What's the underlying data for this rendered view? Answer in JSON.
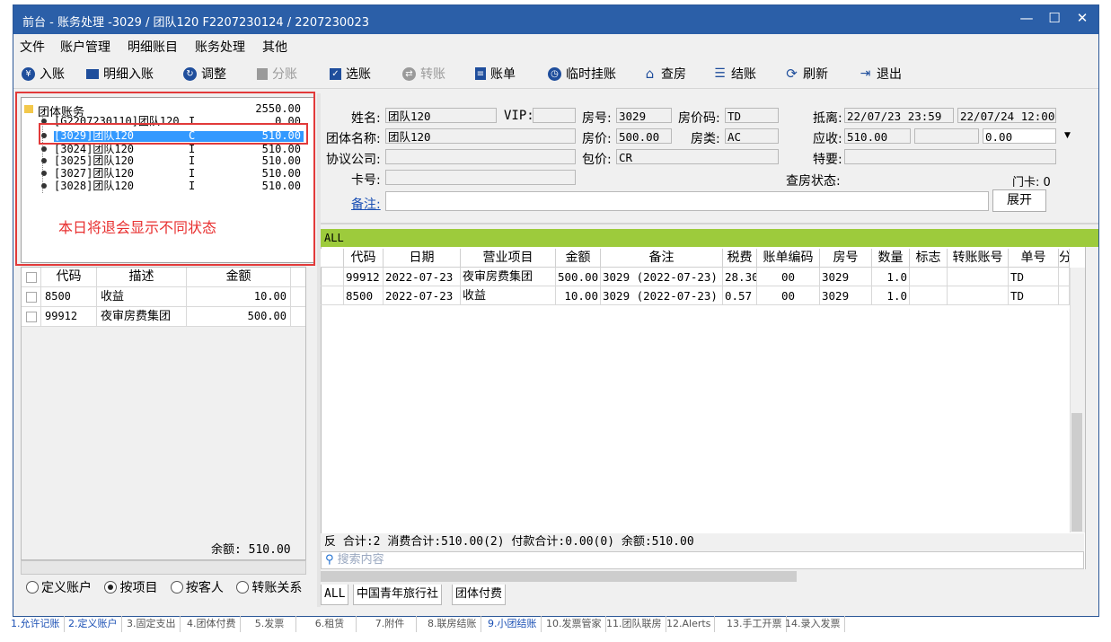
{
  "window": {
    "title": "前台 - 账务处理 -3029 / 团队120  F2207230124 / 2207230023",
    "minimize_glyph": "—",
    "maximize_glyph": "☐",
    "close_glyph": "✕"
  },
  "menu": [
    "文件",
    "账户管理",
    "明细账目",
    "账务处理",
    "其他"
  ],
  "toolbar": [
    {
      "label": "入账",
      "icon": "yen-icon",
      "enabled": true
    },
    {
      "label": "明细入账",
      "icon": "monitor-icon",
      "enabled": true
    },
    {
      "label": "调整",
      "icon": "adjust-icon",
      "enabled": true
    },
    {
      "label": "分账",
      "icon": "split-icon",
      "enabled": false
    },
    {
      "label": "选账",
      "icon": "select-icon",
      "enabled": true
    },
    {
      "label": "转账",
      "icon": "transfer-icon",
      "enabled": false
    },
    {
      "label": "账单",
      "icon": "bill-icon",
      "enabled": true
    },
    {
      "label": "临时挂账",
      "icon": "clock-icon",
      "enabled": true
    },
    {
      "label": "查房",
      "icon": "house-icon",
      "enabled": true
    },
    {
      "label": "结账",
      "icon": "coins-icon",
      "enabled": true
    },
    {
      "label": "刷新",
      "icon": "refresh-icon",
      "enabled": true
    },
    {
      "label": "退出",
      "icon": "exit-icon",
      "enabled": true
    }
  ],
  "tree": {
    "root_label": "团体账务",
    "root_amount": "2550.00",
    "items": [
      {
        "name": "[G2207230110]团队120",
        "flag": "I",
        "amount": "0.00",
        "selected": false
      },
      {
        "name": "[3029]团队120",
        "flag": "C",
        "amount": "510.00",
        "selected": true
      },
      {
        "name": "[3024]团队120",
        "flag": "I",
        "amount": "510.00",
        "selected": false
      },
      {
        "name": "[3025]团队120",
        "flag": "I",
        "amount": "510.00",
        "selected": false
      },
      {
        "name": "[3027]团队120",
        "flag": "I",
        "amount": "510.00",
        "selected": false
      },
      {
        "name": "[3028]团队120",
        "flag": "I",
        "amount": "510.00",
        "selected": false
      }
    ],
    "annotation": "本日将退会显示不同状态"
  },
  "left_grid": {
    "headers": [
      "代码",
      "描述",
      "金额"
    ],
    "rows": [
      {
        "code": "8500",
        "desc": "收益",
        "amount": "10.00"
      },
      {
        "code": "99912",
        "desc": "夜审房费集团",
        "amount": "500.00"
      }
    ],
    "balance": "余额: 510.00"
  },
  "radios": [
    {
      "label": "定义账户",
      "checked": false
    },
    {
      "label": "按项目",
      "checked": true
    },
    {
      "label": "按客人",
      "checked": false
    },
    {
      "label": "转账关系",
      "checked": false
    }
  ],
  "form": {
    "name_label": "姓名:",
    "name_value": "团队120",
    "vip_label": "VIP:",
    "vip_value": "",
    "room_label": "房号:",
    "room_value": "3029",
    "ratecode_label": "房价码:",
    "ratecode_value": "TD",
    "arrdep_label": "抵离:",
    "arrival": "22/07/23 23:59",
    "departure": "22/07/24 12:00",
    "group_label": "团体名称:",
    "group_value": "团队120",
    "rate_label": "房价:",
    "rate_value": "500.00",
    "roomtype_label": "房类:",
    "roomtype_value": "AC",
    "receivable_label": "应收:",
    "receivable_value": "510.00",
    "receivable_extra": "",
    "receivable_combo": "0.00",
    "agreement_label": "协议公司:",
    "agreement_value": "",
    "package_label": "包价:",
    "package_value": "CR",
    "special_label": "特要:",
    "special_value": "",
    "card_label": "卡号:",
    "card_value": "",
    "checkstatus_label": "查房状态:",
    "doorcard_label": "门卡: 0",
    "remark_label": "备注:",
    "remark_value": "",
    "expand_button": "展开"
  },
  "right_grid": {
    "filter_label": "ALL",
    "headers": [
      "代码",
      "日期",
      "营业项目",
      "金额",
      "备注",
      "税费",
      "账单编码",
      "房号",
      "数量",
      "标志",
      "转账账号",
      "单号",
      "分"
    ],
    "rows": [
      {
        "code": "99912",
        "date": "2022-07-23",
        "item": "夜审房费集团",
        "amount": "500.00",
        "note": "3029 (2022-07-23)",
        "tax": "28.30",
        "bill": "00",
        "room": "3029",
        "qty": "1.0",
        "flag": "",
        "transfer": "",
        "ticket": "TD"
      },
      {
        "code": "8500",
        "date": "2022-07-23",
        "item": "收益",
        "amount": "10.00",
        "note": "3029 (2022-07-23)",
        "tax": "0.57",
        "bill": "00",
        "room": "3029",
        "qty": "1.0",
        "flag": "",
        "transfer": "",
        "ticket": "TD"
      }
    ],
    "totals_prefix": "反",
    "totals": "合计:2  消费合计:510.00(2)  付款合计:0.00(0)  余额:510.00",
    "search_placeholder": "搜索内容"
  },
  "bottom_tabs": [
    "ALL",
    "中国青年旅行社",
    "团体付费"
  ],
  "status_tabs": [
    {
      "label": "1.允许记账",
      "blue": true
    },
    {
      "label": "2.定义账户",
      "blue": true
    },
    {
      "label": "3.固定支出",
      "blue": false
    },
    {
      "label": "4.团体付费",
      "blue": false
    },
    {
      "label": "5.发票",
      "blue": false
    },
    {
      "label": "6.租赁",
      "blue": false
    },
    {
      "label": "7.附件",
      "blue": false
    },
    {
      "label": "8.联房结账",
      "blue": false
    },
    {
      "label": "9.小团结账",
      "blue": true
    },
    {
      "label": "10.发票管家",
      "blue": false
    },
    {
      "label": "11.团队联房",
      "blue": false
    },
    {
      "label": "12.Alerts",
      "blue": false
    },
    {
      "label": "13.手工开票",
      "blue": false
    },
    {
      "label": "14.录入发票",
      "blue": false
    }
  ],
  "colors": {
    "titlebar": "#2b5fa8",
    "allbar": "#9dcb3c",
    "selection": "#3399ff",
    "annotation": "#e83030"
  }
}
